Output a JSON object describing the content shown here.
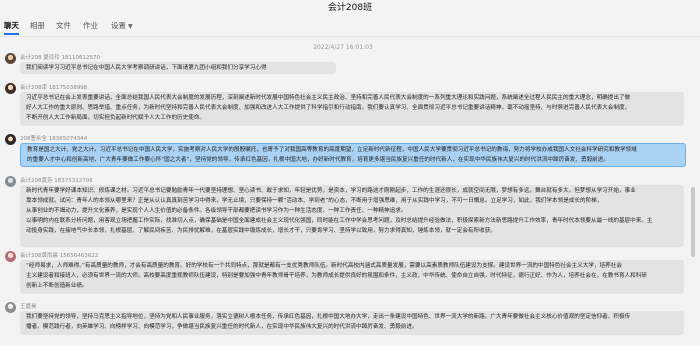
{
  "window": {
    "title": "会计208班"
  },
  "tabs": [
    {
      "label": "聊天"
    },
    {
      "label": "相册"
    },
    {
      "label": "文件"
    },
    {
      "label": "作业"
    },
    {
      "label": "设置"
    }
  ],
  "timestamp": "2022/4/27 16:01:03",
  "messages": [
    {
      "sender": "会计208 夏玲玲 18110612570",
      "lines": [
        "我们阅读学习习近平总书记在中国人民大学考察调研讲话，下面请第九团小组和我们分享学习心得"
      ]
    },
    {
      "sender": "会计208漆 18175038998",
      "lines": [
        "习近平总书记在会上发表重要讲话，全面总结我国人民代表大会制度的发展历程，深刻阐述新时代发展中国特色社会主义民主政治、坚持和完善人民代表大会制度的一系列重大理论和实践问题，系统阐述全过程人民民主的重大理念，明确提出了做",
        "好人大工作的重大原则、思路举措、重点任务，为新时代坚持和完善人民代表大会制度、加强和改进人大工作提供了科学指引和行动指南。我们要认真学习、全面贯彻习近平总书记重要讲话精神，毫不动摇坚持、与时俱进完善人民代表大会制度，",
        "不断开创人大工作新局面，切实担负起新时代赋予人大工作的历史使命。"
      ]
    },
    {
      "sender": "208曹永全 18365074344",
      "selected": true,
      "lines": [
        "教育是国之大计、党之大计。习近平总书记在中国人民大学，实施考察对人民大学的殷殷嘱托，也寄予了对我国高等教育的高度期望，立足新时代新征程，中国人民大学要贯彻习近平总书记的教诲，努力将学校办成我国人文社会科学研究和教学领域",
        "的重要人才中心和创新高地，广大青年要做工作要心怀“国之大者”，坚持党的领导，传承红色基因，扎根中国大地，办好新时代教育，培育更多堪当民族复兴重任的时代新人，在实现中华民族伟大复兴的时代洪流中踔厉奋发、勇毅前进。"
      ]
    },
    {
      "sender": "会计208黄芳 18375312706",
      "lines": [
        "新时代青年要学好课本知识、修炼课之材。习近平总书记要勉励青年一代要坚持理想、坚心读书、敢于求知，年轻是优势，是资本，学习的路途才刚刚起步，工作的生涯还很长，成就空间无限，梦想有多远，舞台就有多大。但梦想从学习开始，事业",
        "靠本领成就。试问：青年人的本领从哪里来？正是从认认真真刻苦学习中得来，学无止境，只要保持一颗“活动本、学到老”的心态，不断用于增强思维，用于从实践中学习，不可一日懈怠。立足学习，如此，我们学本领是成长的阶梯，",
        "从事创业的不竭动力，提升文化素养，是实现个人人生价值的必备条件。各级领导干部都要把读书学习作为一种生活态度、一种工作责任、一种精神追求。",
        "以事明的内在联系分析问题，用客观立场把握工作实际，找准切入点，确保基础是中国全面建成社会主义现代化强国，同时能在工作中学会思考问题，及时总结提升经验做法，积极探索新方法新思路提升工作效率，青年时代本领要从最一线的基层中来。主",
        "动投身实践，在接地气中长本领，扎根基层、了解民间疾苦、为民排忧解难，在基层实践中锻炼成长，增长才干，只要肯学习、坚持学以致用，努力求得真知，锤炼本领，就一定会有所收获。"
      ]
    },
    {
      "sender": "会计208黄雨晨 15656463622",
      "lines": [
        "“经师易求，人师难得。”有高质量的教师，才会有高质量的教育。好的学校有一个共同特点，那就是都有一支优秀教师队伍。新时代高校内涵式高质量发展，需要以高素质教师队伍建设为支撑。建设世界一流的中国特色社会主义大学，培养社会",
        "主义建设者和接班人，必须有世界一流的大师。高校要高度重视教师队伍建设，特别是要加强中青年教师骨干培养，为教师成长提供良好的氛围和条件，主义政、中华传统、使命自立自强，时代特征，德行正好、作为人，培养社会在，在教书育人和科研",
        "创新上不断创造新业绩。"
      ]
    },
    {
      "sender": "王嘉昊",
      "lines": [
        "我们要坚持党的领导，坚持马克思主义指导地位，坚持为党和人民事业服务，落实立德树人根本任务，传承红色基因，扎根中国大地办大学，走出一条建设中国特色、世界一流大学的新路。广大青年要做社会主义核心价值观的坚定信仰者、积极传",
        "播者、模范践行者，向英雄学习、向榜样学习、向模范学习，争做堪当民族复兴重任的时代新人，在实现中华民族伟大复兴的时代洪流中踔厉奋发、勇毅前进。"
      ]
    }
  ]
}
